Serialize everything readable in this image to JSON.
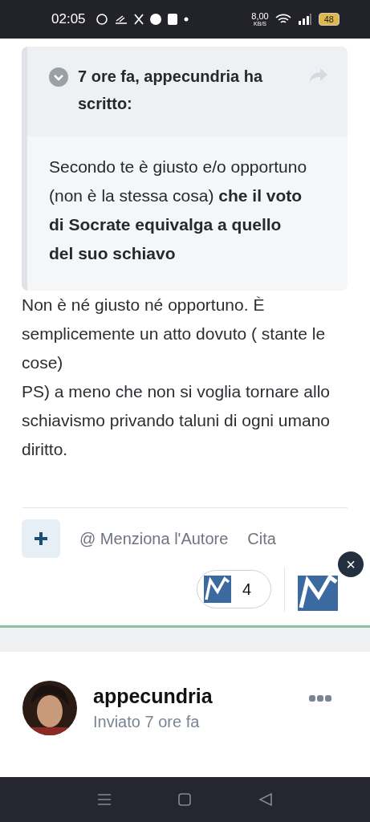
{
  "status_bar": {
    "time": "02:05",
    "net_speed": "8,00",
    "net_unit": "KB/S",
    "battery": "48"
  },
  "quote": {
    "header": "7 ore fa, appecundria ha scritto:",
    "body": "Secondo te è giusto e/o opportuno (non è la stessa cosa) **che il voto di Socrate equivalga a quello del suo schiavo**"
  },
  "post_text": [
    "Non è né giusto né opportuno. È semplicemente un atto dovuto ( stante le cose)",
    "PS) a meno che non si voglia tornare allo schiavismo privando taluni di ogni umano diritto."
  ],
  "actions": {
    "mention": "@ Menziona l'Autore",
    "quote": "Cita"
  },
  "reactions": {
    "count": "4",
    "close": "×"
  },
  "next_post": {
    "author": "appecundria",
    "meta": "Inviato 7 ore fa"
  }
}
